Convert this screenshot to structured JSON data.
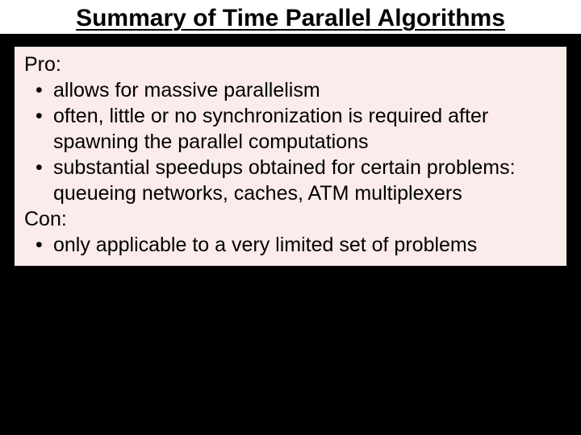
{
  "title": "Summary of Time Parallel Algorithms",
  "pro": {
    "heading": "Pro:",
    "items": [
      "allows for massive parallelism",
      "often, little or no synchronization is required after spawning the parallel computations",
      "substantial speedups obtained for certain problems: queueing networks, caches, ATM multiplexers"
    ]
  },
  "con": {
    "heading": "Con:",
    "items": [
      "only applicable to a very limited set of problems"
    ]
  }
}
